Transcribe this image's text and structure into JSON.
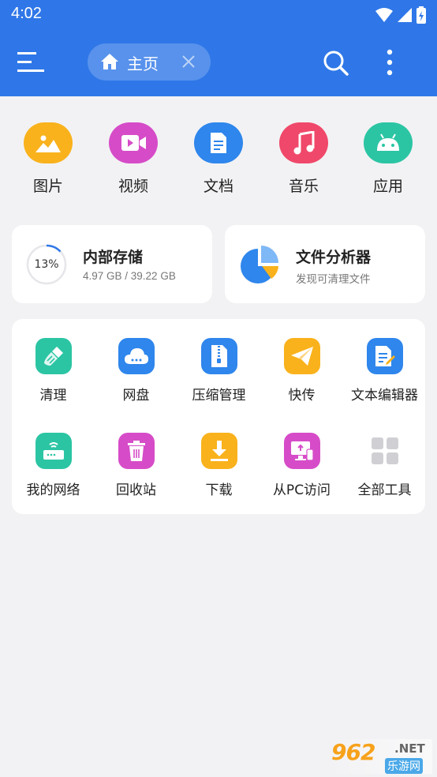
{
  "status_bar": {
    "time": "4:02"
  },
  "app_bar": {
    "tab_label": "主页",
    "menu_icon": "hamburger-menu-icon",
    "search_icon": "search-icon",
    "more_icon": "more-vertical-icon"
  },
  "categories": [
    {
      "label": "图片",
      "icon": "image-icon",
      "color": "#f9b21c"
    },
    {
      "label": "视频",
      "icon": "video-icon",
      "color": "#d64cc8"
    },
    {
      "label": "文档",
      "icon": "document-icon",
      "color": "#2f86ec"
    },
    {
      "label": "音乐",
      "icon": "music-icon",
      "color": "#f0486a"
    },
    {
      "label": "应用",
      "icon": "android-icon",
      "color": "#2cc5a4"
    }
  ],
  "storage": {
    "title": "内部存储",
    "percent_label": "13%",
    "percent": 13,
    "detail": "4.97 GB / 39.22 GB"
  },
  "analyzer": {
    "title": "文件分析器",
    "subtitle": "发现可清理文件"
  },
  "tools": [
    {
      "label": "清理",
      "icon": "broom-icon",
      "color": "#2cc5a4"
    },
    {
      "label": "网盘",
      "icon": "cloud-icon",
      "color": "#2f86ec"
    },
    {
      "label": "压缩管理",
      "icon": "zip-icon",
      "color": "#2f86ec"
    },
    {
      "label": "快传",
      "icon": "paper-plane-icon",
      "color": "#f9b21c"
    },
    {
      "label": "文本编辑器",
      "icon": "text-edit-icon",
      "color": "#2f86ec"
    },
    {
      "label": "我的网络",
      "icon": "router-icon",
      "color": "#2cc5a4"
    },
    {
      "label": "回收站",
      "icon": "trash-icon",
      "color": "#d64cc8"
    },
    {
      "label": "下载",
      "icon": "download-icon",
      "color": "#f9b21c"
    },
    {
      "label": "从PC访问",
      "icon": "pc-access-icon",
      "color": "#d64cc8"
    },
    {
      "label": "全部工具",
      "icon": "all-tools-grid-icon",
      "color": "#d0d0d4"
    }
  ],
  "watermark": {
    "logo": "962",
    "net": ".NET",
    "text": "乐游网"
  },
  "colors": {
    "primary": "#2f77e8",
    "background": "#f2f2f4"
  }
}
